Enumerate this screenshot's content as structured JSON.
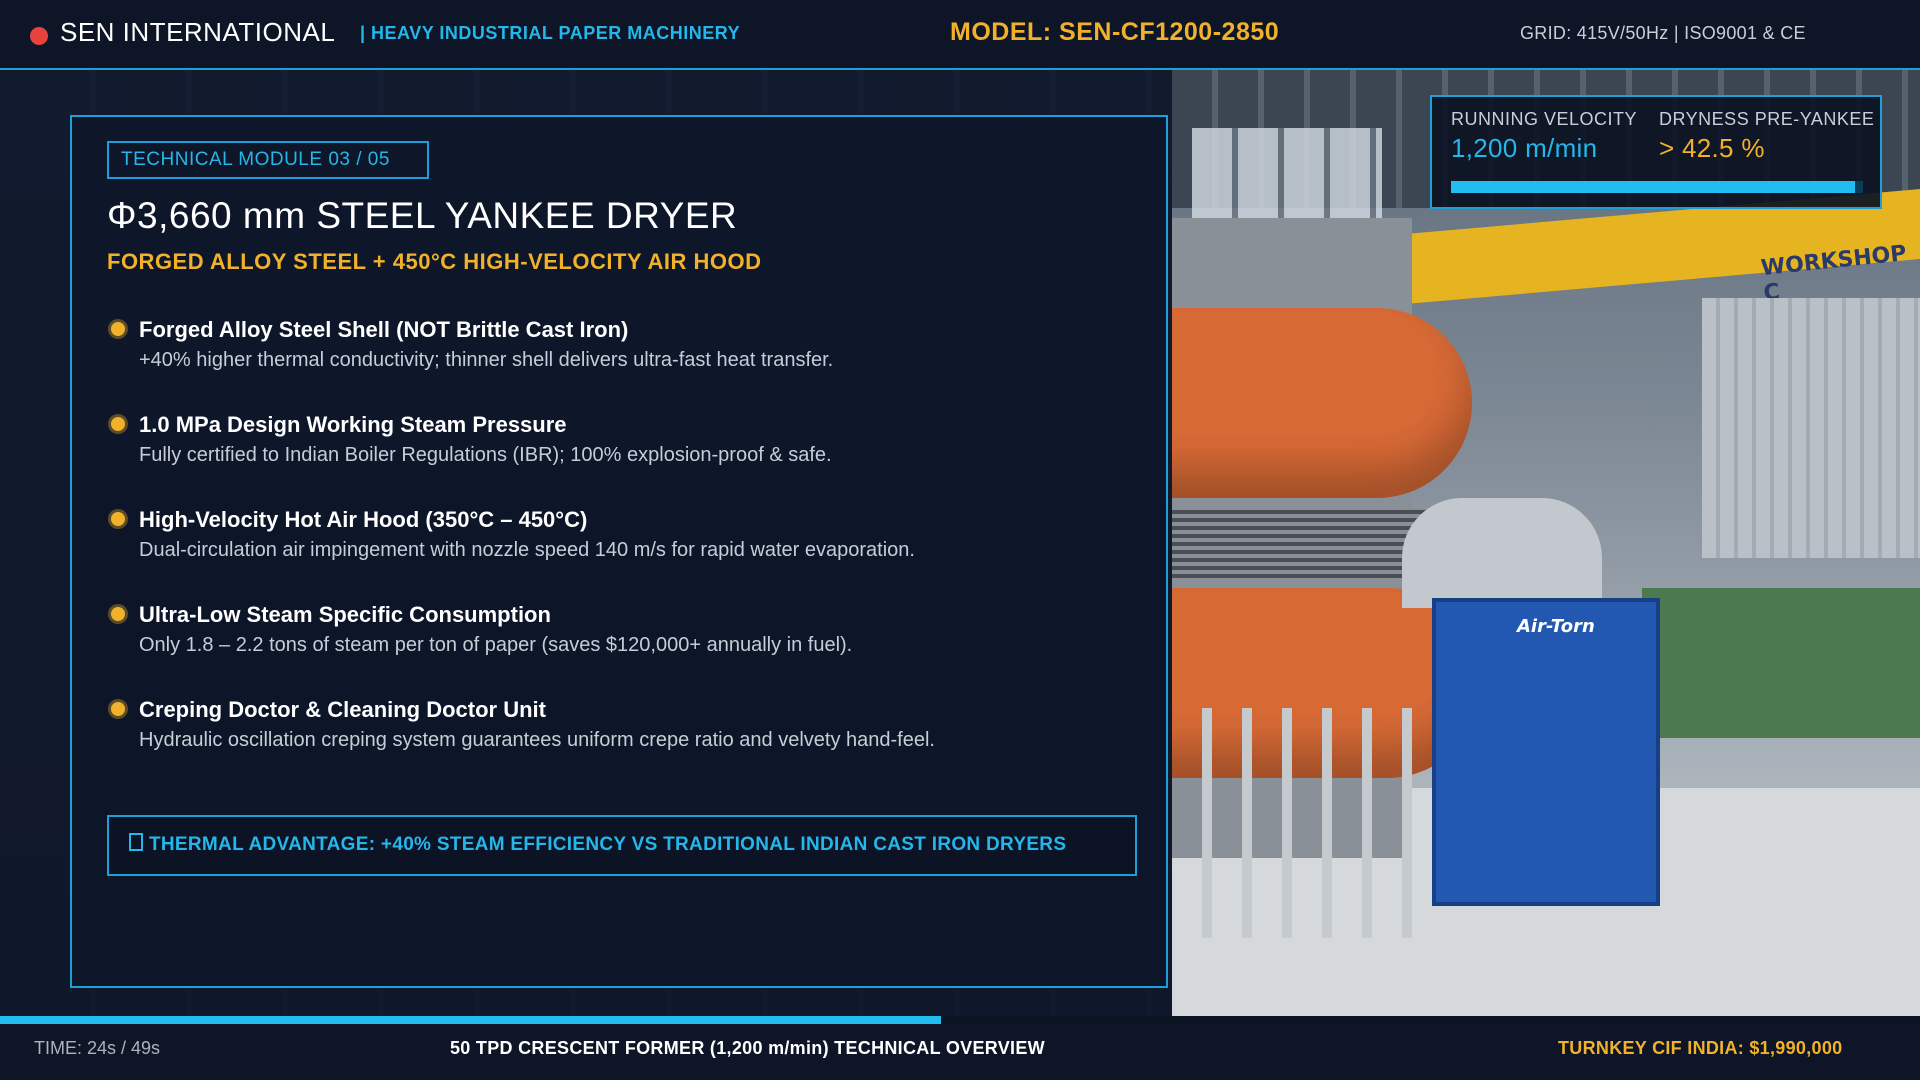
{
  "header": {
    "brand": "SEN INTERNATIONAL",
    "subtitle": "| HEAVY INDUSTRIAL PAPER MACHINERY",
    "model": "MODEL: SEN-CF1200-2850",
    "grid": "GRID: 415V/50Hz  |  ISO9001 & CE"
  },
  "panel": {
    "module_tag": "TECHNICAL MODULE 03 / 05",
    "title": "Φ3,660 mm STEEL YANKEE DRYER",
    "subtitle": "FORGED ALLOY STEEL + 450°C HIGH-VELOCITY AIR HOOD",
    "features": [
      {
        "title": "Forged Alloy Steel Shell (NOT Brittle Cast Iron)",
        "desc": "+40% higher thermal conductivity; thinner shell delivers ultra-fast heat transfer."
      },
      {
        "title": "1.0 MPa Design Working Steam Pressure",
        "desc": "Fully certified to Indian Boiler Regulations (IBR); 100% explosion-proof & safe."
      },
      {
        "title": "High-Velocity Hot Air Hood (350°C – 450°C)",
        "desc": "Dual-circulation air impingement with nozzle speed 140 m/s for rapid water evaporation."
      },
      {
        "title": "Ultra-Low Steam Specific Consumption",
        "desc": "Only 1.8 – 2.2 tons of steam per ton of paper (saves $120,000+ annually in fuel)."
      },
      {
        "title": "Creping Doctor & Cleaning Doctor Unit",
        "desc": "Hydraulic oscillation creping system guarantees uniform crepe ratio and velvety hand-feel."
      }
    ],
    "advantage": "THERMAL ADVANTAGE: +40% STEAM EFFICIENCY VS TRADITIONAL INDIAN CAST IRON DRYERS"
  },
  "metrics": {
    "velocity_label": "RUNNING VELOCITY",
    "velocity_value": "1,200 m/min",
    "dryness_label": "DRYNESS PRE-YANKEE",
    "dryness_value": "> 42.5 %",
    "bar_fill_fraction": 0.98
  },
  "footer": {
    "time": "TIME: 24s / 49s",
    "overview": "50 TPD CRESCENT FORMER (1,200 m/min) TECHNICAL OVERVIEW",
    "price": "TURNKEY CIF INDIA: $1,990,000",
    "progress_fraction": 0.49
  },
  "scene": {
    "blower_label": "Air-Torn",
    "shop_text": "WORKSHOP C"
  },
  "colors": {
    "accent_cyan": "#25b6ea",
    "accent_gold": "#f2b12b",
    "brand_red": "#e8423f",
    "panel_bg": "#0e1628"
  },
  "icons": {
    "brand_marker": "red-dot-icon",
    "feature_bullet": "gold-dot-icon",
    "advantage_marker": "square-outline-icon"
  }
}
